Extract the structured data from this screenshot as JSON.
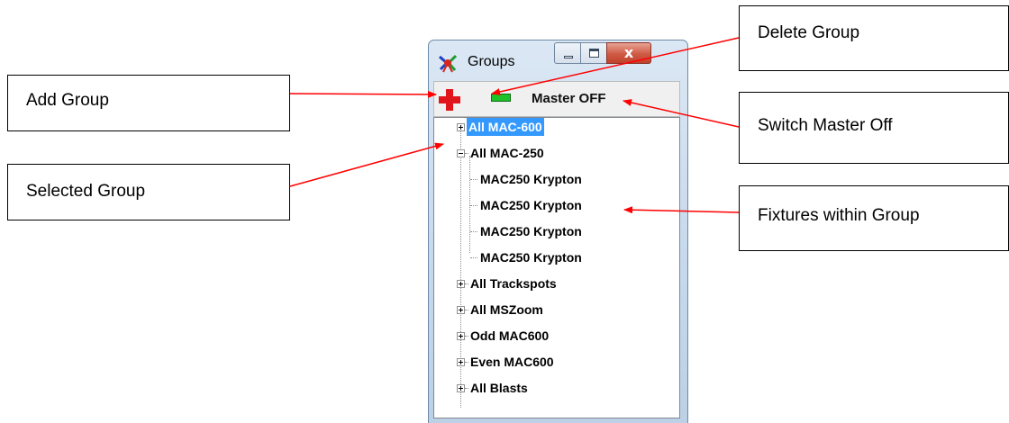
{
  "window": {
    "title": "Groups",
    "close_glyph": "x"
  },
  "toolbar": {
    "master_label": "Master OFF"
  },
  "tree": {
    "items": [
      {
        "label": "All MAC-600",
        "selected": true,
        "expanded": false
      },
      {
        "label": "All MAC-250",
        "expanded": true
      },
      {
        "label": "MAC250 Krypton",
        "child": true
      },
      {
        "label": "MAC250 Krypton",
        "child": true
      },
      {
        "label": "MAC250 Krypton",
        "child": true
      },
      {
        "label": "MAC250 Krypton",
        "child": true
      },
      {
        "label": "All Trackspots",
        "expanded": false
      },
      {
        "label": "All MSZoom",
        "expanded": false
      },
      {
        "label": "Odd MAC600",
        "expanded": false
      },
      {
        "label": "Even MAC600",
        "expanded": false
      },
      {
        "label": "All Blasts",
        "expanded": false
      }
    ]
  },
  "callouts": {
    "add_group": "Add Group",
    "selected_group": "Selected Group",
    "delete_group": "Delete Group",
    "switch_master_off": "Switch Master Off",
    "fixtures_within_group": "Fixtures within Group"
  },
  "colors": {
    "arrow": "#ff0000",
    "selection": "#3399ff",
    "add_icon": "#e0161c",
    "delete_icon": "#1ec12a",
    "close_button": "#cf5b45"
  },
  "icons": {
    "app": "spotlight-icon",
    "add": "plus-icon",
    "delete": "minus-icon",
    "minimize": "minimize-icon",
    "maximize": "maximize-icon",
    "close": "close-icon"
  }
}
